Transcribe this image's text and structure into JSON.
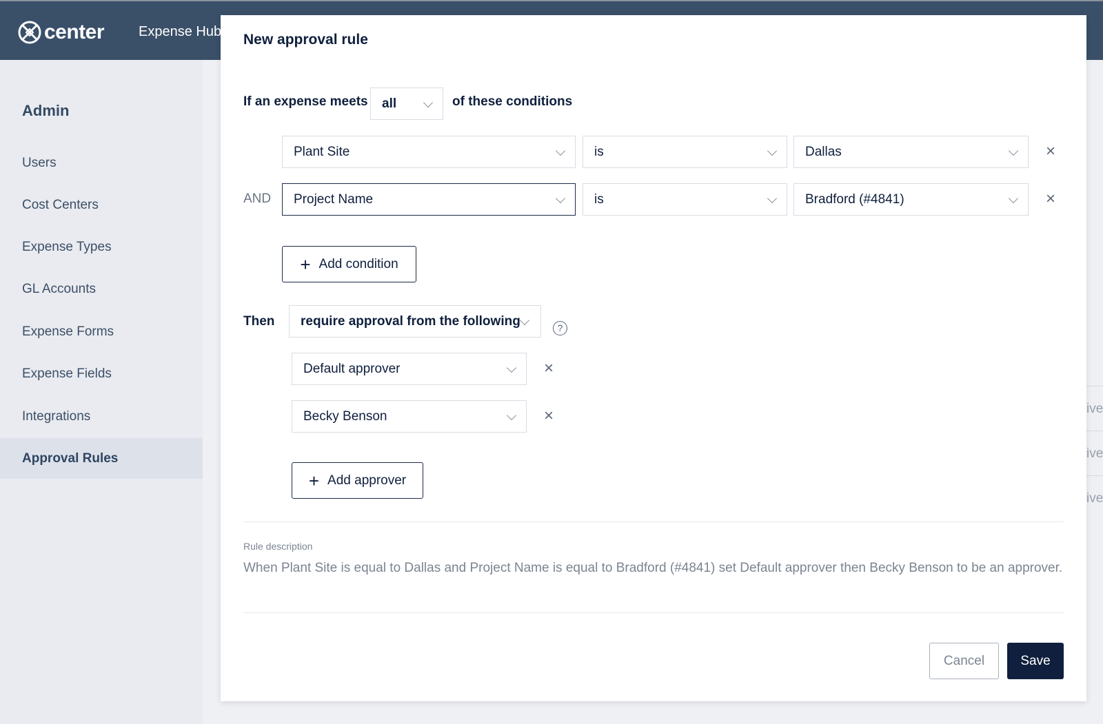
{
  "app": {
    "logo": "center",
    "section": "Expense Hub"
  },
  "sidebar": {
    "heading": "Admin",
    "items": [
      {
        "label": "Users"
      },
      {
        "label": "Cost Centers"
      },
      {
        "label": "Expense Types"
      },
      {
        "label": "GL Accounts"
      },
      {
        "label": "Expense Forms"
      },
      {
        "label": "Expense Fields"
      },
      {
        "label": "Integrations"
      },
      {
        "label": "Approval Rules",
        "active": true
      }
    ]
  },
  "background_rows": [
    "ive",
    "ive",
    "ive"
  ],
  "modal": {
    "title": "New approval rule",
    "condition_prefix": "If an expense meets",
    "match": "all",
    "condition_suffix": "of these conditions",
    "conditions": [
      {
        "connector": "",
        "field": "Plant Site",
        "operator": "is",
        "value": "Dallas"
      },
      {
        "connector": "AND",
        "field": "Project Name",
        "operator": "is",
        "value": "Bradford (#4841)"
      }
    ],
    "add_condition": "Add condition",
    "then_label": "Then",
    "action": "require approval from the following",
    "approvers": [
      "Default approver",
      "Becky Benson"
    ],
    "add_approver": "Add approver",
    "description_label": "Rule description",
    "description": "When Plant Site is equal to Dallas and Project Name is equal to Bradford (#4841) set Default approver then Becky Benson to be an approver.",
    "cancel": "Cancel",
    "save": "Save"
  },
  "colors": {
    "header": "#3a4f68",
    "primary": "#0f1f3d"
  }
}
